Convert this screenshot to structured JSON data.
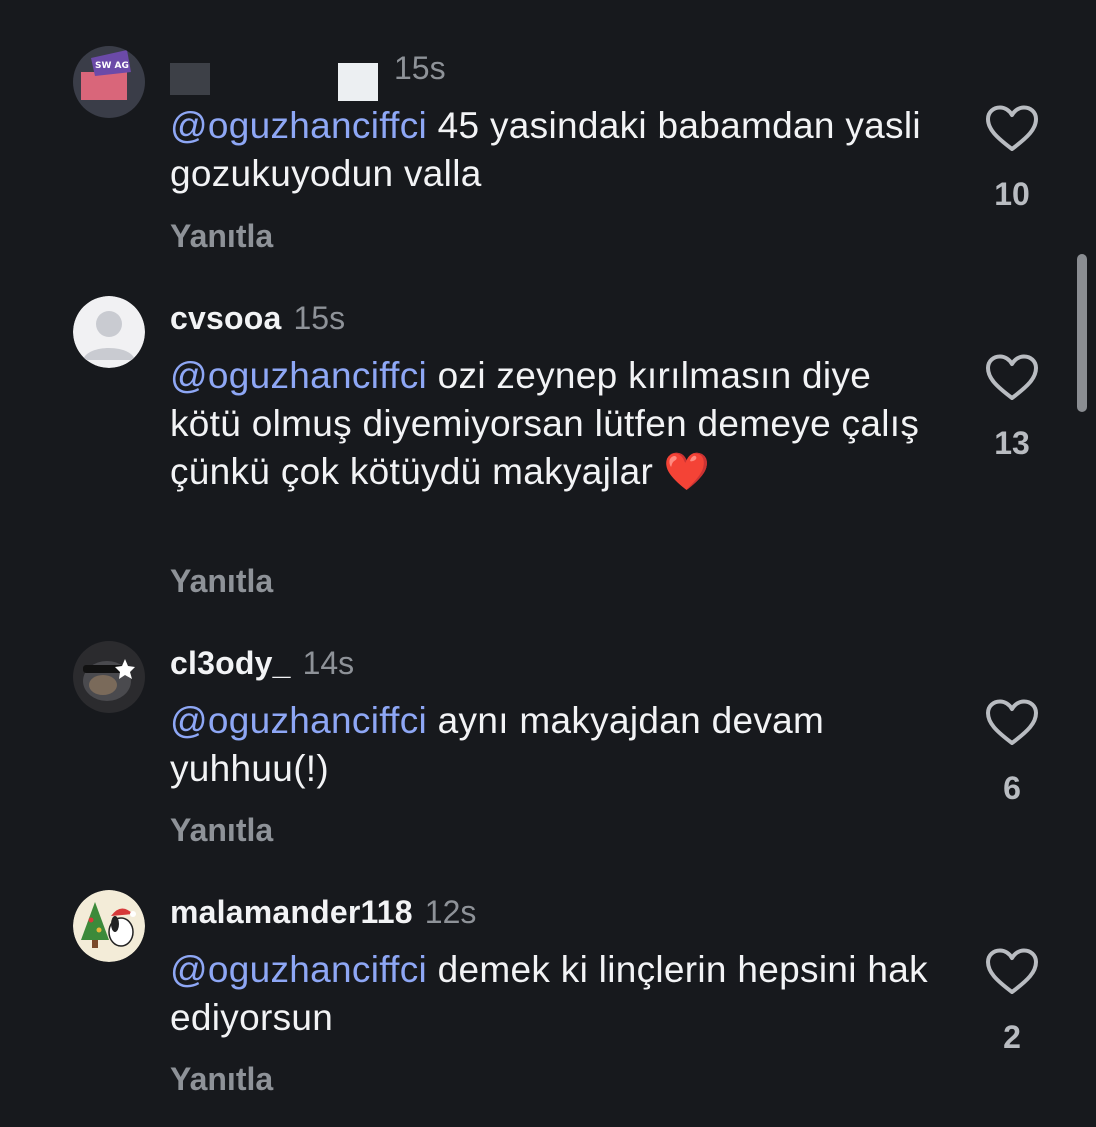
{
  "comments": [
    {
      "username": "",
      "time": "15s",
      "mention": "@oguzhanciffci",
      "text": " 45 yasindaki babamdan yasli gozukuyodun valla",
      "reply_label": "Yanıtla",
      "likes": "10",
      "avatar_icon": "sticker-avatar-icon"
    },
    {
      "username": "cvsooa",
      "time": "15s",
      "mention": "@oguzhanciffci",
      "text": " ozi zeynep kırılmasın diye kötü olmuş diyemiyorsan lütfen demeye çalış çünkü çok kötüydü makyajlar ❤️",
      "reply_label": "Yanıtla",
      "likes": "13",
      "avatar_icon": "default-user-avatar-icon"
    },
    {
      "username": "cl3ody_",
      "time": "14s",
      "mention": "@oguzhanciffci",
      "text": " aynı makyajdan devam yuhhuu(!)",
      "reply_label": "Yanıtla",
      "likes": "6",
      "avatar_icon": "cat-photo-avatar-icon"
    },
    {
      "username": "malamander118",
      "time": "12s",
      "mention": "@oguzhanciffci",
      "text": " demek ki linçlerin hepsini hak ediyorsun",
      "reply_label": "Yanıtla",
      "likes": "2",
      "avatar_icon": "christmas-snoopy-avatar-icon"
    }
  ],
  "colors": {
    "background": "#17191d",
    "mention": "#8ea7f5",
    "secondary_text": "#8e9298",
    "primary_text": "#f2f3f5"
  },
  "icons": {
    "like": "heart-outline-icon"
  }
}
